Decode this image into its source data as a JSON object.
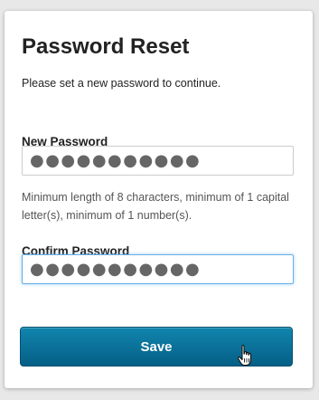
{
  "form": {
    "title": "Password Reset",
    "subtitle": "Please set a new password to continue.",
    "new_password": {
      "label": "New Password",
      "value": "●●●●●●●●●●●"
    },
    "hint": "Minimum length of 8 characters, minimum of 1 capital letter(s), minimum of 1 number(s).",
    "confirm_password": {
      "label": "Confirm Password",
      "value": "●●●●●●●●●●●"
    },
    "save_label": "Save"
  },
  "colors": {
    "button": "#0b7199",
    "focus_border": "#66afe9",
    "page_background": "#e8e8e8"
  },
  "cursor": {
    "icon": "hand-pointer-cursor-icon"
  }
}
